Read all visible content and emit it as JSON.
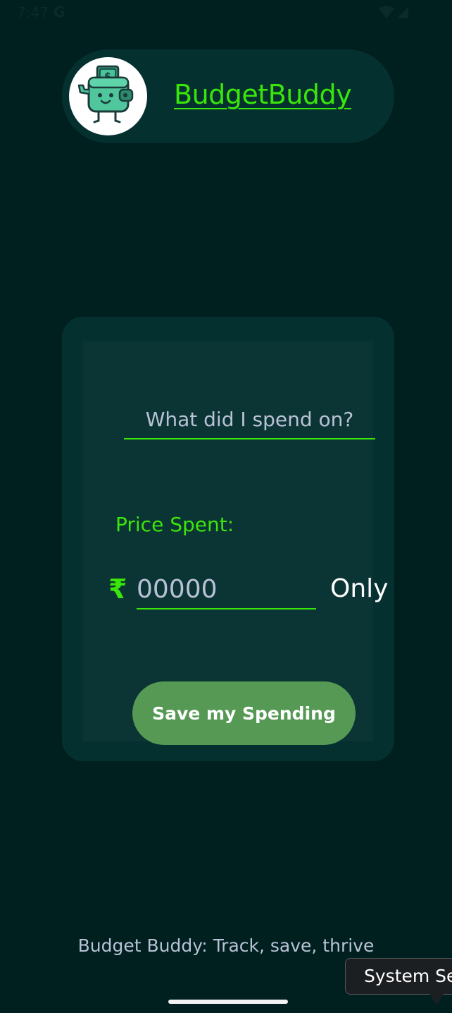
{
  "status_bar": {
    "time": "7:47",
    "carrier_icon": "G",
    "icons": [
      "wifi-icon",
      "signal-icon"
    ]
  },
  "header": {
    "logo_icon": "wallet-mascot-icon",
    "title": "BudgetBuddy"
  },
  "form": {
    "spend_placeholder": "What did I spend on?",
    "price_label": "Price Spent:",
    "currency_symbol": "₹",
    "price_placeholder": "00000",
    "price_suffix": "Only",
    "save_label": "Save my Spending"
  },
  "footer": {
    "tagline": "Budget Buddy: Track, save, thrive"
  },
  "tooltip": {
    "text": "System Se"
  },
  "colors": {
    "background": "#001f1f",
    "card": "#053030",
    "accent": "#39e60a",
    "button": "#559955"
  }
}
